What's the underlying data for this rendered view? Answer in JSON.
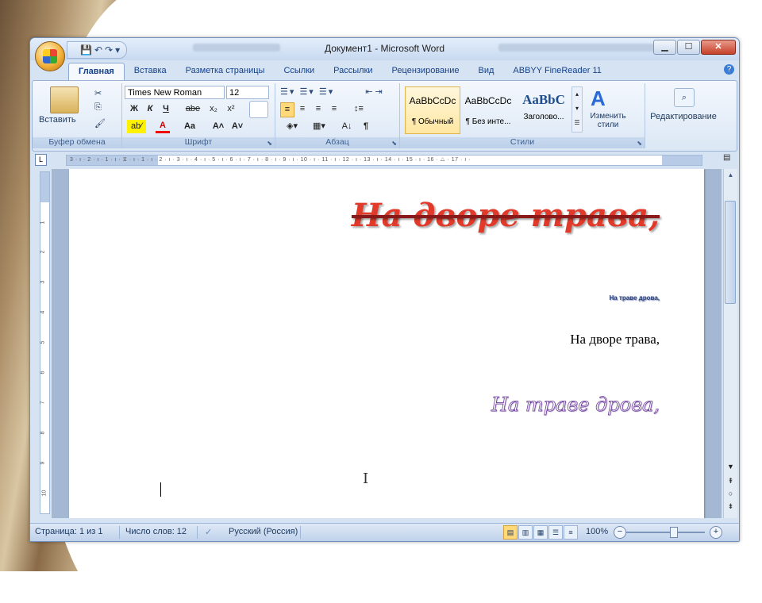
{
  "window": {
    "title": "Документ1 - Microsoft Word",
    "controls": {
      "minimize": "▁",
      "maximize": "☐",
      "close": "✕"
    }
  },
  "quick_access": {
    "save": "💾",
    "undo": "↶",
    "redo": "↷",
    "more": "▾"
  },
  "tabs": [
    {
      "label": "Главная",
      "active": true
    },
    {
      "label": "Вставка"
    },
    {
      "label": "Разметка страницы"
    },
    {
      "label": "Ссылки"
    },
    {
      "label": "Рассылки"
    },
    {
      "label": "Рецензирование"
    },
    {
      "label": "Вид"
    },
    {
      "label": "ABBYY FineReader 11"
    }
  ],
  "ribbon": {
    "clipboard": {
      "label": "Буфер обмена",
      "paste": "Вставить",
      "cut": "✂",
      "copy": "⎘",
      "format": "🖌"
    },
    "font": {
      "label": "Шрифт",
      "family": "Times New Roman",
      "size": "12",
      "bold": "Ж",
      "italic": "К",
      "underline": "Ч",
      "strike": "abe",
      "sub": "x₂",
      "sup": "x²",
      "highlight": "ab⁄",
      "color": "A",
      "case": "Aa",
      "grow": "A˄",
      "shrink": "A˅"
    },
    "paragraph": {
      "label": "Абзац",
      "show_marks": "¶",
      "sort": "A↓"
    },
    "styles": {
      "label": "Стили",
      "items": [
        {
          "sample": "AaBbCcDc",
          "name": "¶ Обычный",
          "selected": true
        },
        {
          "sample": "AaBbCcDc",
          "name": "¶ Без инте..."
        },
        {
          "sample": "AaBbC",
          "name": "Заголово..."
        }
      ],
      "change": "Изменить стили"
    },
    "editing": {
      "label": "Редактирование"
    }
  },
  "ruler": {
    "numbers": "3 · ı · 2 · ı · 1 · ı · ⧖ · ı · 1 · ı · 2 · ı · 3 · ı · 4 · ı · 5 · ı · 6 · ı · 7 · ı · 8 · ı · 9 · ı · 10 · ı · 11 · ı · 12 · ı · 13 · ı · 14 · ı · 15 · ı · 16 · △ · 17 · ı ·",
    "vertical": [
      "1",
      "2",
      "3",
      "4",
      "5",
      "6",
      "7",
      "8",
      "9",
      "10"
    ]
  },
  "document": {
    "line1": "На дворе трава,",
    "line2": "На траве дрова,",
    "line3": "На дворе трава,",
    "line4": "На траве дрова,"
  },
  "status": {
    "page": "Страница: 1 из 1",
    "words": "Число слов: 12",
    "language": "Русский (Россия)",
    "zoom": "100%",
    "zoom_minus": "−",
    "zoom_plus": "+"
  },
  "colors": {
    "accent": "#15428b",
    "heading_red": "#e23a2a",
    "outline_purple": "#6a3a9a"
  }
}
